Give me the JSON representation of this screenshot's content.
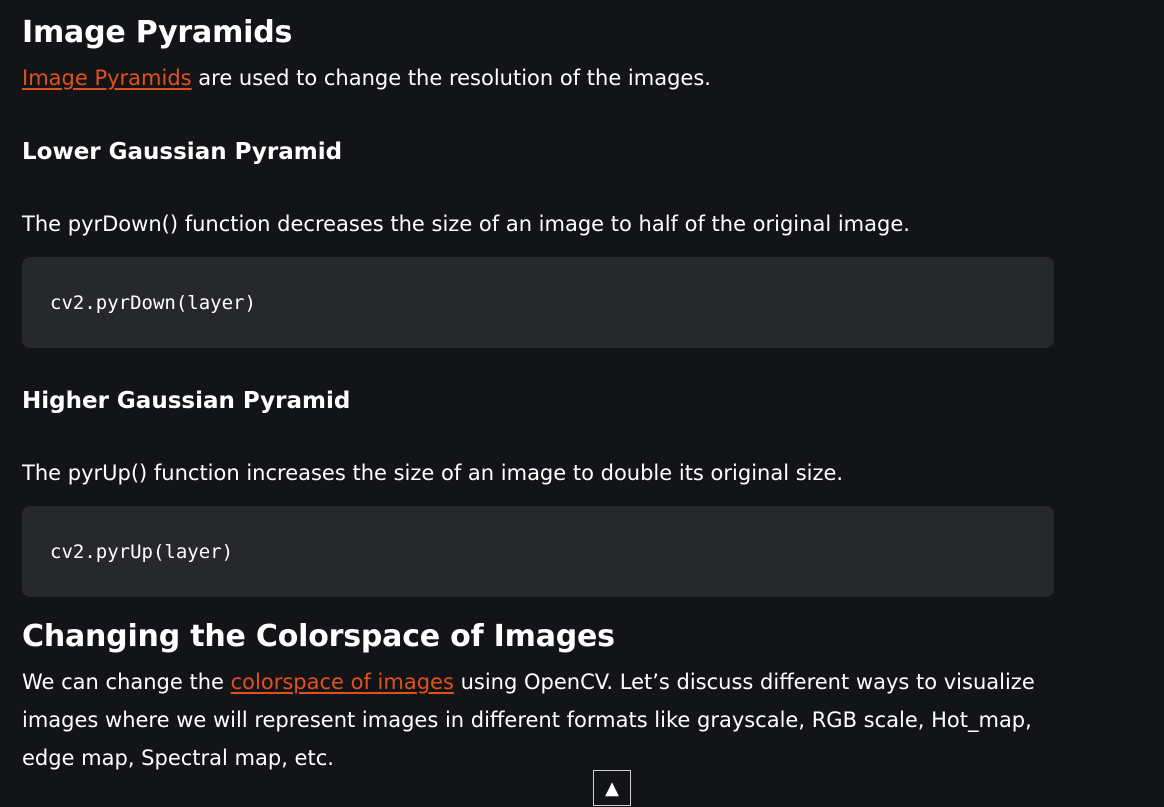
{
  "sections": {
    "pyramids": {
      "title": "Image Pyramids",
      "intro_link": "Image Pyramids",
      "intro_rest": " are used to change the resolution of the images."
    },
    "lower": {
      "title": "Lower Gaussian Pyramid",
      "desc": "The pyrDown() function decreases the size of an image to half of the original image.",
      "code": "cv2.pyrDown(layer)"
    },
    "higher": {
      "title": "Higher Gaussian Pyramid",
      "desc": "The pyrUp() function increases the size of an image to double its original size.",
      "code": "cv2.pyrUp(layer)"
    },
    "colorspace": {
      "title": "Changing the Colorspace of Images",
      "text_before": "We can change the ",
      "link": "colorspace of images",
      "text_after": " using OpenCV. Let’s discuss different ways to visualize images where we will represent images in different formats like grayscale, RGB scale, Hot_map, edge map, Spectral map, etc."
    }
  },
  "scroll_top": {
    "icon": "▲"
  },
  "colors": {
    "background": "#131417",
    "link": "#e2511c",
    "code_bg": "#27282c"
  }
}
